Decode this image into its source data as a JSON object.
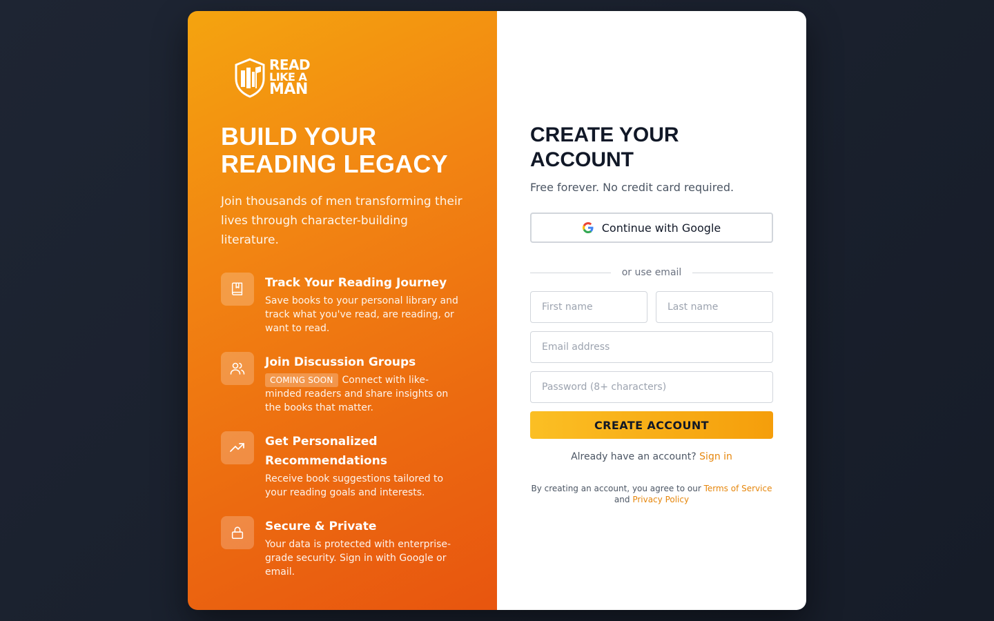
{
  "brand": {
    "logo_line1": "READ",
    "logo_line2": "LIKE A",
    "logo_line3": "MAN",
    "primary_color": "#f28512",
    "accent_color": "#f59e0b"
  },
  "hero": {
    "title": "BUILD YOUR READING LEGACY",
    "subtitle": "Join thousands of men transforming their lives through character-building literature."
  },
  "features": [
    {
      "icon": "book-icon",
      "title": "Track Your Reading Journey",
      "badge": "",
      "description": "Save books to your personal library and track what you've read, are reading, or want to read."
    },
    {
      "icon": "users-icon",
      "title": "Join Discussion Groups",
      "badge": "COMING SOON",
      "description": "Connect with like-minded readers and share insights on the books that matter."
    },
    {
      "icon": "trending-up-icon",
      "title": "Get Personalized Recommendations",
      "badge": "",
      "description": "Receive book suggestions tailored to your reading goals and interests."
    },
    {
      "icon": "lock-icon",
      "title": "Secure & Private",
      "badge": "",
      "description": "Your data is protected with enterprise-grade security. Sign in with Google or email."
    }
  ],
  "form": {
    "title": "CREATE YOUR ACCOUNT",
    "subtitle": "Free forever. No credit card required.",
    "google_label": "Continue with Google",
    "divider": "or use email",
    "first_name_placeholder": "First name",
    "last_name_placeholder": "Last name",
    "email_placeholder": "Email address",
    "password_placeholder": "Password (8+ characters)",
    "submit_label": "CREATE ACCOUNT",
    "signin_prompt": "Already have an account?",
    "signin_link": "Sign in",
    "legal_prefix": "By creating an account, you agree to our",
    "terms_link": "Terms of Service",
    "legal_and": "and",
    "privacy_link": "Privacy Policy"
  }
}
